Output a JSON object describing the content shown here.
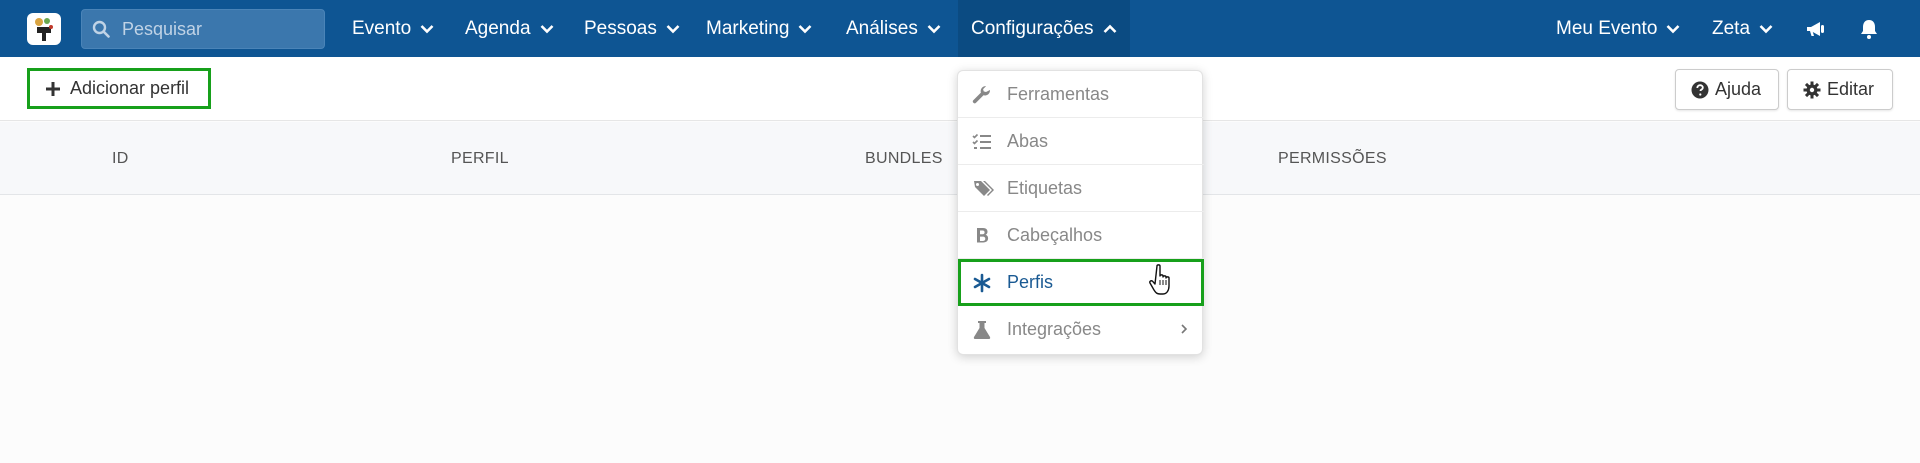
{
  "nav": {
    "search_placeholder": "Pesquisar",
    "items": [
      {
        "label": "Evento"
      },
      {
        "label": "Agenda"
      },
      {
        "label": "Pessoas"
      },
      {
        "label": "Marketing"
      },
      {
        "label": "Análises"
      },
      {
        "label": "Configurações"
      }
    ],
    "right": [
      {
        "label": "Meu Evento"
      },
      {
        "label": "Zeta"
      }
    ],
    "colors": {
      "bar": "#0e5593",
      "active": "#0b4b82",
      "search_bg": "#3b77ad"
    }
  },
  "toolbar": {
    "add_label": "Adicionar perfil",
    "help_label": "Ajuda",
    "edit_label": "Editar"
  },
  "table": {
    "columns": [
      "ID",
      "PERFIL",
      "BUNDLES",
      "PERMISSÕES"
    ]
  },
  "dropdown": {
    "items": [
      {
        "label": "Ferramentas",
        "icon": "wrench-icon"
      },
      {
        "label": "Abas",
        "icon": "checklist-icon"
      },
      {
        "label": "Etiquetas",
        "icon": "tags-icon"
      },
      {
        "label": "Cabeçalhos",
        "icon": "bold-icon"
      },
      {
        "label": "Perfis",
        "icon": "asterisk-icon"
      },
      {
        "label": "Integrações",
        "icon": "flask-icon"
      }
    ],
    "active_index": 4,
    "highlight_color": "#17a01b"
  }
}
